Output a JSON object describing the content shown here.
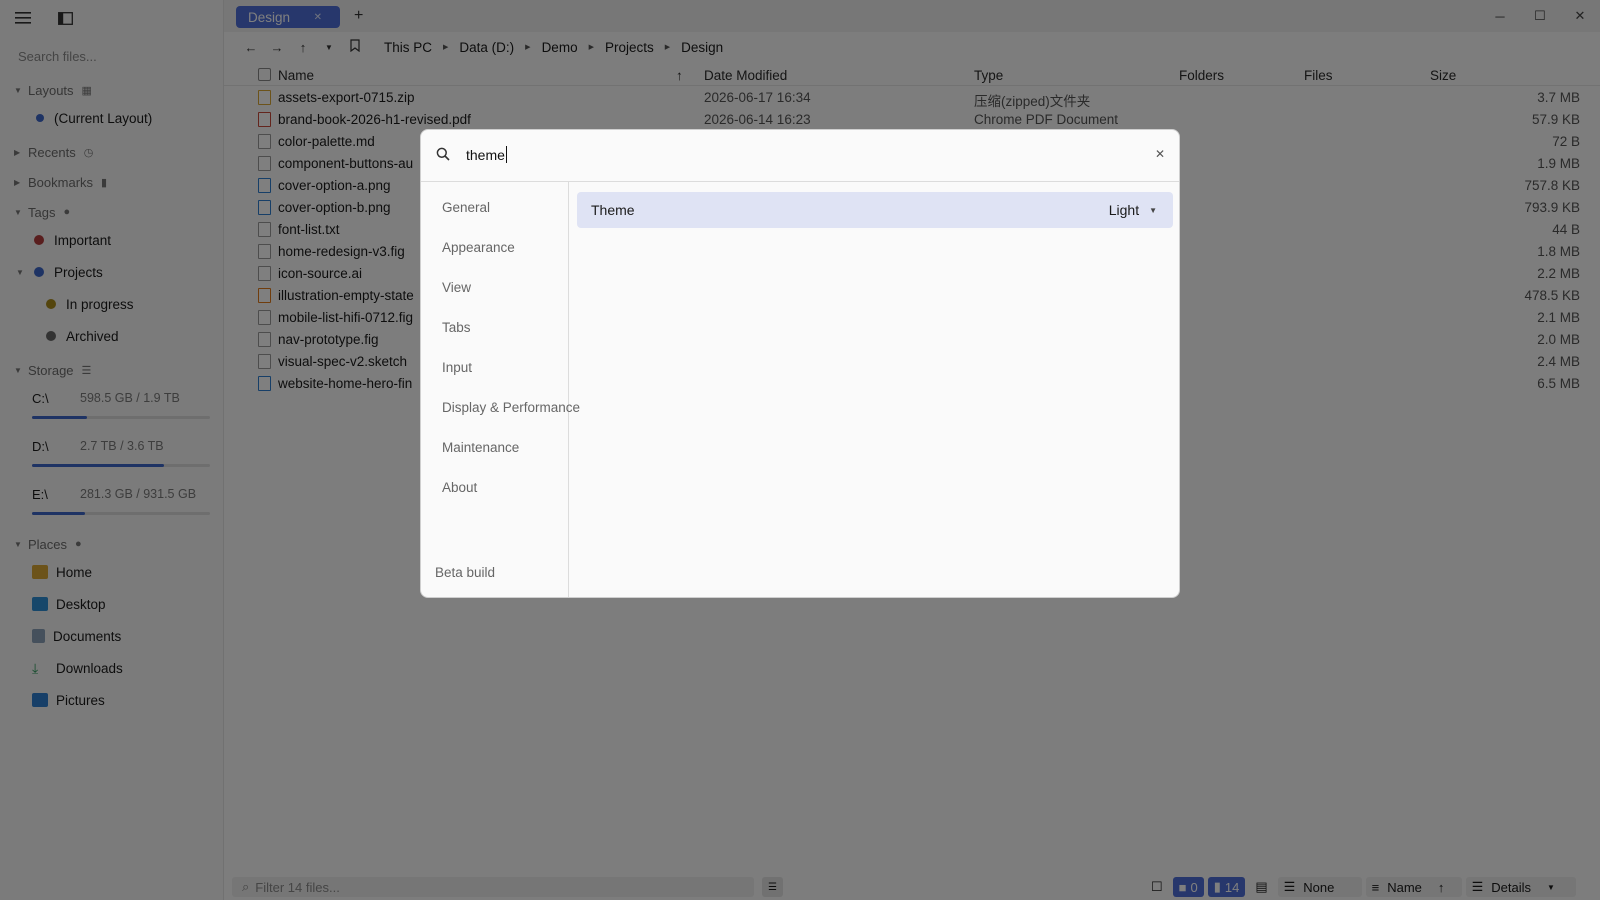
{
  "sidebar": {
    "search_placeholder": "Search files...",
    "sections": {
      "layouts": "Layouts",
      "recents": "Recents",
      "bookmarks": "Bookmarks",
      "tags": "Tags",
      "storage": "Storage",
      "places": "Places"
    },
    "current_layout": "(Current Layout)",
    "tags": [
      {
        "label": "Important",
        "color": "#b33c3c"
      },
      {
        "label": "Projects",
        "color": "#3d67c9"
      },
      {
        "label": "In progress",
        "color": "#a88a1a"
      },
      {
        "label": "Archived",
        "color": "#666666"
      }
    ],
    "drives": [
      {
        "name": "C:\\",
        "size": "598.5 GB / 1.9 TB",
        "fill": 0.31
      },
      {
        "name": "D:\\",
        "size": "2.7 TB / 3.6 TB",
        "fill": 0.74
      },
      {
        "name": "E:\\",
        "size": "281.3 GB / 931.5 GB",
        "fill": 0.3
      }
    ],
    "places": [
      "Home",
      "Desktop",
      "Documents",
      "Downloads",
      "Pictures"
    ]
  },
  "tabs": [
    {
      "label": "Design"
    }
  ],
  "breadcrumb": [
    "This PC",
    "Data (D:)",
    "Demo",
    "Projects",
    "Design"
  ],
  "columns": {
    "name": "Name",
    "date": "Date Modified",
    "type": "Type",
    "folders": "Folders",
    "files": "Files",
    "size": "Size"
  },
  "files": [
    {
      "name": "assets-export-0715.zip",
      "date": "2026-06-17 16:34",
      "type": "压缩(zipped)文件夹",
      "size": "3.7 MB"
    },
    {
      "name": "brand-book-2026-h1-revised.pdf",
      "date": "2026-06-14 16:23",
      "type": "Chrome PDF Document",
      "size": "57.9 KB"
    },
    {
      "name": "color-palette.md",
      "date": "",
      "type": "",
      "size": "72 B"
    },
    {
      "name": "component-buttons-au",
      "date": "",
      "type": "",
      "size": "1.9 MB"
    },
    {
      "name": "cover-option-a.png",
      "date": "",
      "type": "",
      "size": "757.8 KB"
    },
    {
      "name": "cover-option-b.png",
      "date": "",
      "type": "",
      "size": "793.9 KB"
    },
    {
      "name": "font-list.txt",
      "date": "",
      "type": "",
      "size": "44 B"
    },
    {
      "name": "home-redesign-v3.fig",
      "date": "",
      "type": "",
      "size": "1.8 MB"
    },
    {
      "name": "icon-source.ai",
      "date": "",
      "type": "",
      "size": "2.2 MB"
    },
    {
      "name": "illustration-empty-state",
      "date": "",
      "type": "",
      "size": "478.5 KB"
    },
    {
      "name": "mobile-list-hifi-0712.fig",
      "date": "",
      "type": "",
      "size": "2.1 MB"
    },
    {
      "name": "nav-prototype.fig",
      "date": "",
      "type": "",
      "size": "2.0 MB"
    },
    {
      "name": "visual-spec-v2.sketch",
      "date": "",
      "type": "",
      "size": "2.4 MB"
    },
    {
      "name": "website-home-hero-fin",
      "date": "",
      "type": "",
      "size": "6.5 MB"
    }
  ],
  "statusbar": {
    "filter_placeholder": "Filter 14 files...",
    "folder_count": "0",
    "file_count": "14",
    "group": "None",
    "sort": "Name",
    "view": "Details"
  },
  "settings": {
    "search_value": "theme",
    "nav": [
      "General",
      "Appearance",
      "View",
      "Tabs",
      "Input",
      "Display & Performance",
      "Maintenance",
      "About"
    ],
    "footer": "Beta build",
    "result_label": "Theme",
    "result_value": "Light"
  }
}
